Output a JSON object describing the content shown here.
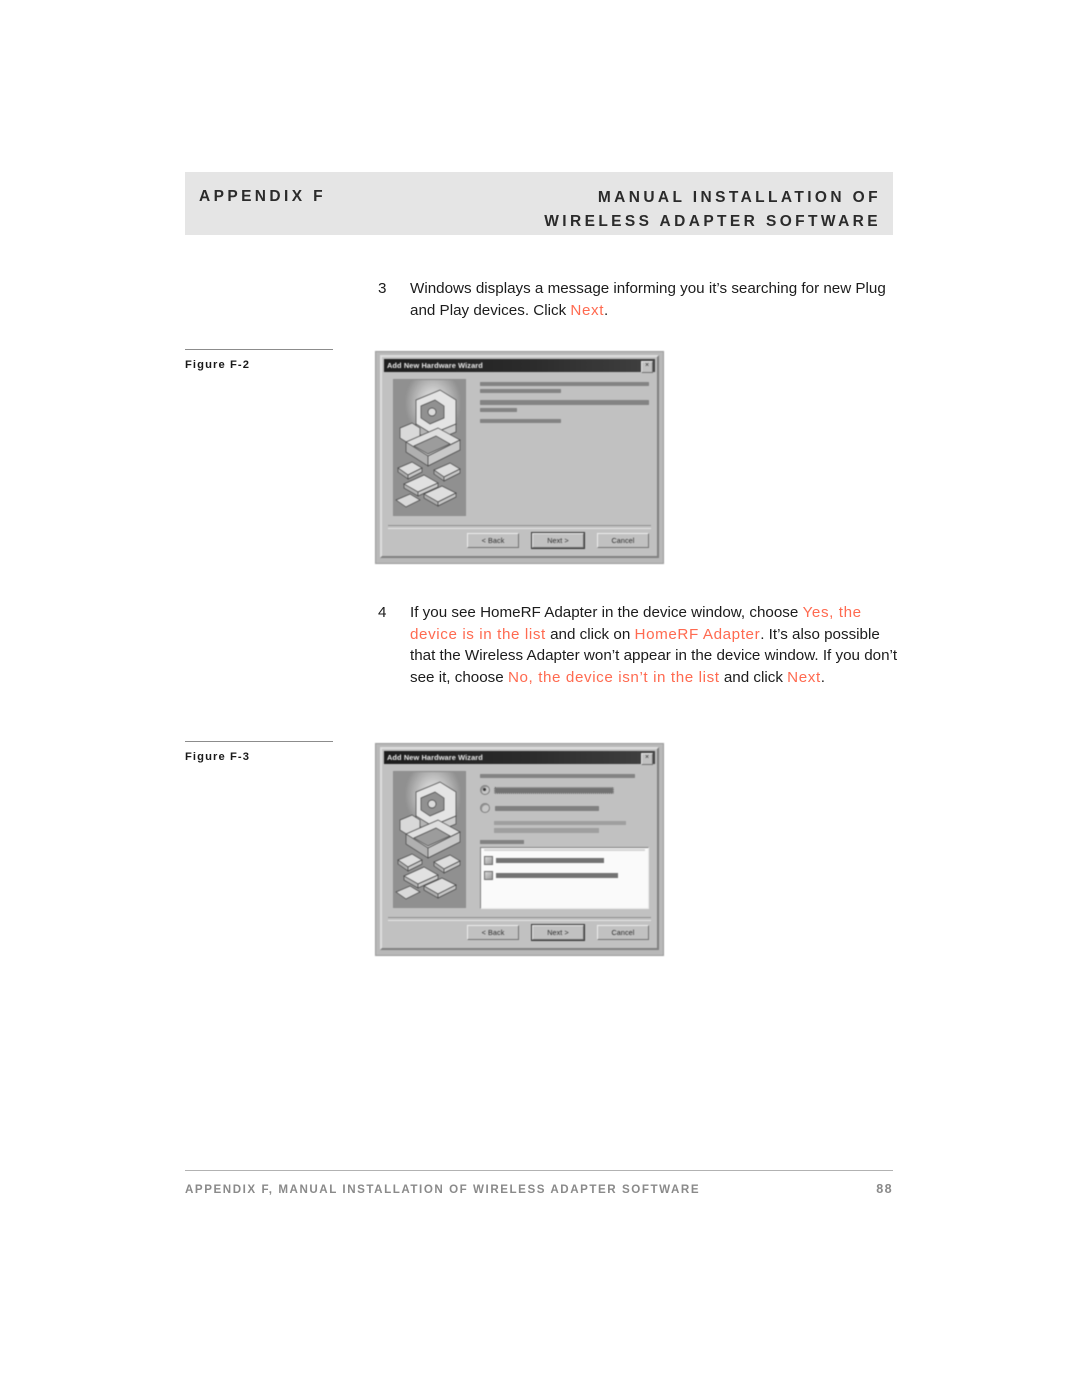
{
  "header": {
    "appendix": "APPENDIX F",
    "title_line1": "MANUAL INSTALLATION OF",
    "title_line2": "WIRELESS ADAPTER SOFTWARE",
    "band_color": "#e5e5e5"
  },
  "accent_color": "#ff6a50",
  "steps": [
    {
      "number": "3",
      "segments": [
        {
          "text": "Windows displays a message informing you it’s searching for new Plug and Play devices. Click ",
          "style": "normal"
        },
        {
          "text": "Next",
          "style": "accent"
        },
        {
          "text": ".",
          "style": "normal"
        }
      ]
    },
    {
      "number": "4",
      "segments": [
        {
          "text": "If you see HomeRF Adapter in the device window, choose ",
          "style": "normal"
        },
        {
          "text": "Yes, the device is in the list",
          "style": "accent"
        },
        {
          "text": " and click on ",
          "style": "normal"
        },
        {
          "text": "HomeRF Adapter",
          "style": "accent"
        },
        {
          "text": ". It’s also possible that the Wireless Adapter won’t appear in the device window. If you don’t see it, choose ",
          "style": "normal"
        },
        {
          "text": "No, the device isn’t in the list",
          "style": "accent"
        },
        {
          "text": " and click ",
          "style": "normal"
        },
        {
          "text": "Next",
          "style": "accent"
        },
        {
          "text": ".",
          "style": "normal"
        }
      ]
    }
  ],
  "figures": [
    {
      "caption": "Figure F-2",
      "dialog": {
        "title": "Add New Hardware Wizard",
        "close_label": "×",
        "illustration": "computer-hardware-illustration",
        "buttons": [
          {
            "label": "< Back",
            "default": false
          },
          {
            "label": "Next >",
            "default": true
          },
          {
            "label": "Cancel",
            "default": false
          }
        ]
      }
    },
    {
      "caption": "Figure F-3",
      "dialog": {
        "title": "Add New Hardware Wizard",
        "close_label": "×",
        "illustration": "computer-hardware-illustration",
        "radio_selected_index": 0,
        "buttons": [
          {
            "label": "< Back",
            "default": false
          },
          {
            "label": "Next >",
            "default": true
          },
          {
            "label": "Cancel",
            "default": false
          }
        ]
      }
    }
  ],
  "footer": {
    "text": "APPENDIX F, MANUAL INSTALLATION OF WIRELESS ADAPTER SOFTWARE",
    "page": "88"
  }
}
